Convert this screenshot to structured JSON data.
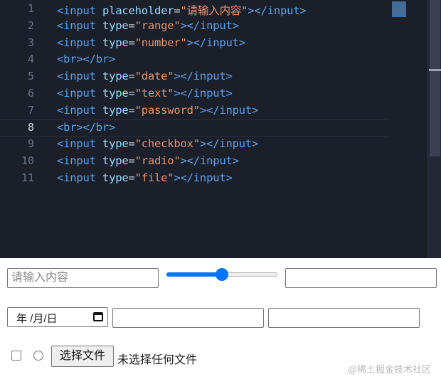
{
  "editor": {
    "lines": [
      {
        "no": "1",
        "tokens": [
          {
            "t": "tag",
            "v": "<input"
          },
          {
            "t": "punc",
            "v": " "
          },
          {
            "t": "attr",
            "v": "placeholder"
          },
          {
            "t": "punc",
            "v": "="
          },
          {
            "t": "str",
            "v": "\"请输入内容\""
          },
          {
            "t": "tag",
            "v": "></input>"
          }
        ]
      },
      {
        "no": "2",
        "tokens": [
          {
            "t": "tag",
            "v": "<input"
          },
          {
            "t": "punc",
            "v": " "
          },
          {
            "t": "attr",
            "v": "type"
          },
          {
            "t": "punc",
            "v": "="
          },
          {
            "t": "str",
            "v": "\"range\""
          },
          {
            "t": "tag",
            "v": "></input>"
          }
        ]
      },
      {
        "no": "3",
        "tokens": [
          {
            "t": "tag",
            "v": "<input"
          },
          {
            "t": "punc",
            "v": " "
          },
          {
            "t": "attr",
            "v": "type"
          },
          {
            "t": "punc",
            "v": "="
          },
          {
            "t": "str",
            "v": "\"number\""
          },
          {
            "t": "tag",
            "v": "></input>"
          }
        ]
      },
      {
        "no": "4",
        "tokens": [
          {
            "t": "tag",
            "v": "<br></br>"
          }
        ]
      },
      {
        "no": "5",
        "tokens": [
          {
            "t": "tag",
            "v": "<input"
          },
          {
            "t": "punc",
            "v": " "
          },
          {
            "t": "attr",
            "v": "type"
          },
          {
            "t": "punc",
            "v": "="
          },
          {
            "t": "str",
            "v": "\"date\""
          },
          {
            "t": "tag",
            "v": "></input>"
          }
        ]
      },
      {
        "no": "6",
        "tokens": [
          {
            "t": "tag",
            "v": "<input"
          },
          {
            "t": "punc",
            "v": " "
          },
          {
            "t": "attr",
            "v": "type"
          },
          {
            "t": "punc",
            "v": "="
          },
          {
            "t": "str",
            "v": "\"text\""
          },
          {
            "t": "tag",
            "v": "></input>"
          }
        ]
      },
      {
        "no": "7",
        "tokens": [
          {
            "t": "tag",
            "v": "<input"
          },
          {
            "t": "punc",
            "v": " "
          },
          {
            "t": "attr",
            "v": "type"
          },
          {
            "t": "punc",
            "v": "="
          },
          {
            "t": "str",
            "v": "\"password\""
          },
          {
            "t": "tag",
            "v": "></input>"
          }
        ]
      },
      {
        "no": "8",
        "active": true,
        "tokens": [
          {
            "t": "tag",
            "v": "<br></br>"
          }
        ]
      },
      {
        "no": "9",
        "tokens": [
          {
            "t": "tag",
            "v": "<input"
          },
          {
            "t": "punc",
            "v": " "
          },
          {
            "t": "attr",
            "v": "type"
          },
          {
            "t": "punc",
            "v": "="
          },
          {
            "t": "str",
            "v": "\"checkbox\""
          },
          {
            "t": "tag",
            "v": "></input>"
          }
        ]
      },
      {
        "no": "10",
        "tokens": [
          {
            "t": "tag",
            "v": "<input"
          },
          {
            "t": "punc",
            "v": " "
          },
          {
            "t": "attr",
            "v": "type"
          },
          {
            "t": "punc",
            "v": "="
          },
          {
            "t": "str",
            "v": "\"radio\""
          },
          {
            "t": "tag",
            "v": "></input>"
          }
        ]
      },
      {
        "no": "11",
        "tokens": [
          {
            "t": "tag",
            "v": "<input"
          },
          {
            "t": "punc",
            "v": " "
          },
          {
            "t": "attr",
            "v": "type"
          },
          {
            "t": "punc",
            "v": "="
          },
          {
            "t": "str",
            "v": "\"file\""
          },
          {
            "t": "tag",
            "v": "></input>"
          }
        ]
      }
    ]
  },
  "form": {
    "text_placeholder": "请输入内容",
    "range_value": 0.5,
    "number_value": "",
    "date_display": "年 /月/日",
    "text_value": "",
    "password_value": "",
    "checkbox_checked": false,
    "radio_checked": false,
    "file_button_label": "选择文件",
    "file_status": "未选择任何文件"
  },
  "watermark": "@稀土掘金技术社区",
  "icons": {
    "calendar": "calendar-icon"
  },
  "colors": {
    "editor_bg": "#1b1f2a",
    "accent": "#0075ff"
  }
}
